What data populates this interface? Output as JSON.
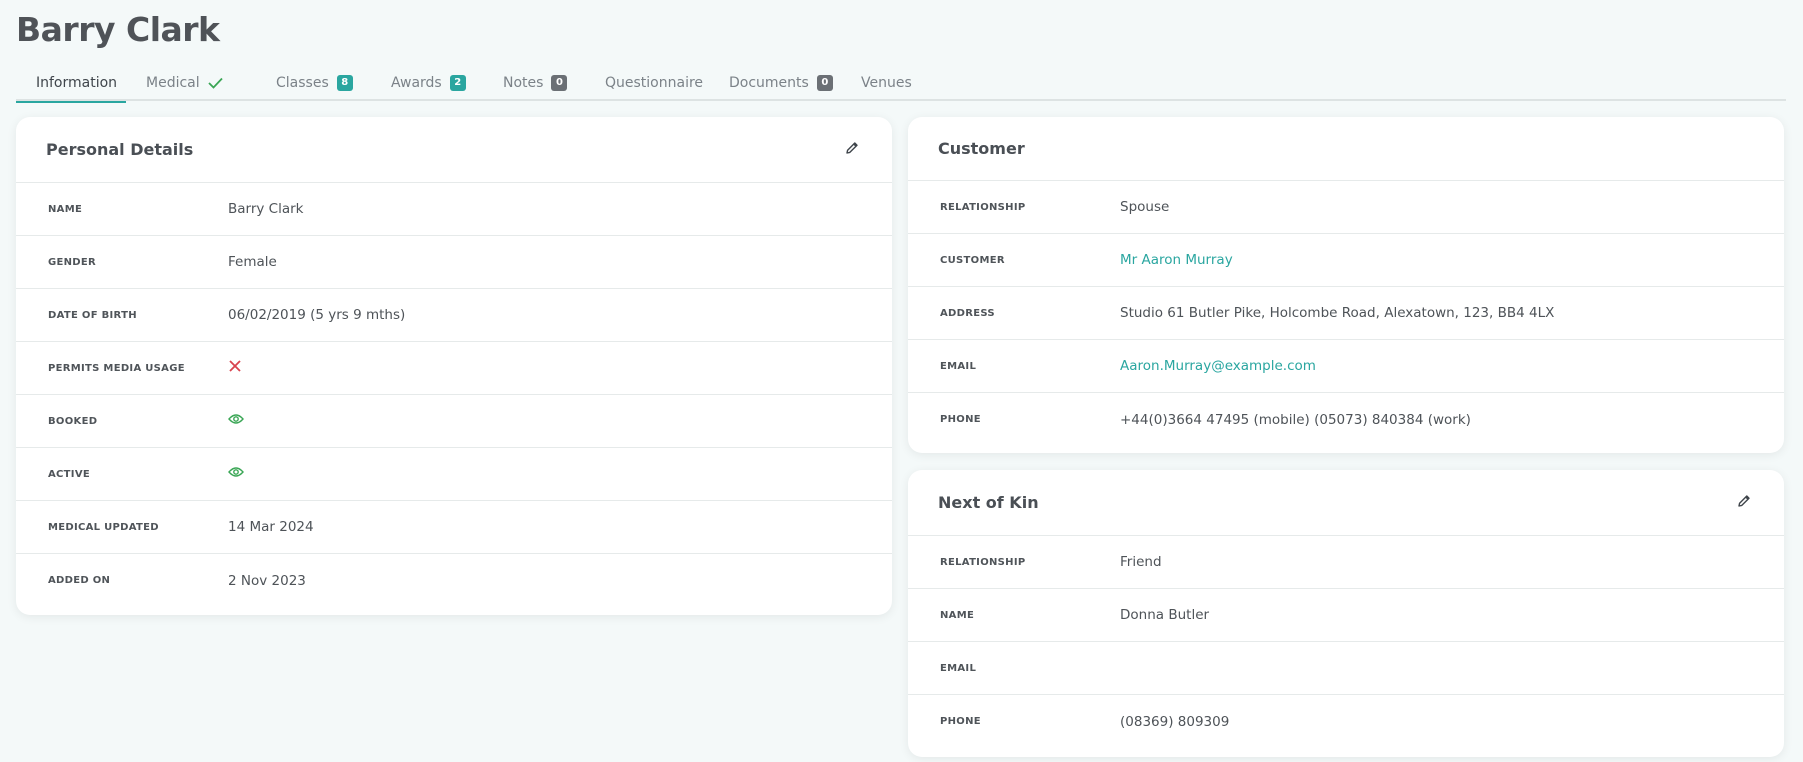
{
  "page": {
    "title": "Barry Clark"
  },
  "tabs": [
    {
      "label": "Information",
      "active": true
    },
    {
      "label": "Medical",
      "icon": "check-icon"
    },
    {
      "label": "Classes",
      "badge": "8"
    },
    {
      "label": "Awards",
      "badge": "2"
    },
    {
      "label": "Notes",
      "badge": "0"
    },
    {
      "label": "Questionnaire"
    },
    {
      "label": "Documents",
      "badge": "0"
    },
    {
      "label": "Venues"
    }
  ],
  "personal": {
    "title": "Personal Details",
    "rows": [
      {
        "label": "NAME",
        "value": "Barry Clark"
      },
      {
        "label": "GENDER",
        "value": "Female"
      },
      {
        "label": "DATE OF BIRTH",
        "value": "06/02/2019 (5 yrs 9 mths)"
      },
      {
        "label": "PERMITS MEDIA USAGE",
        "icon": "cross-icon"
      },
      {
        "label": "BOOKED",
        "icon": "eye-icon"
      },
      {
        "label": "ACTIVE",
        "icon": "eye-icon"
      },
      {
        "label": "MEDICAL UPDATED",
        "value": "14 Mar 2024"
      },
      {
        "label": "ADDED ON",
        "value": "2 Nov 2023"
      }
    ]
  },
  "customer": {
    "title": "Customer",
    "rows": [
      {
        "label": "RELATIONSHIP",
        "value": "Spouse"
      },
      {
        "label": "CUSTOMER",
        "value": "Mr Aaron Murray"
      },
      {
        "label": "ADDRESS",
        "value": "Studio 61 Butler Pike, Holcombe Road, Alexatown, 123, BB4 4LX"
      },
      {
        "label": "EMAIL",
        "value": "Aaron.Murray@example.com"
      },
      {
        "label": "PHONE",
        "value": "+44(0)3664 47495 (mobile) (05073) 840384 (work)"
      }
    ]
  },
  "kin": {
    "title": "Next of Kin",
    "rows": [
      {
        "label": "RELATIONSHIP",
        "value": "Friend"
      },
      {
        "label": "NAME",
        "value": "Donna Butler"
      },
      {
        "label": "EMAIL",
        "value": ""
      },
      {
        "label": "PHONE",
        "value": "(08369) 809309"
      }
    ]
  },
  "colors": {
    "accent": "#2aa6a0",
    "danger": "#d9434e",
    "success": "#3aa655",
    "badge_gray": "#6b7075"
  }
}
